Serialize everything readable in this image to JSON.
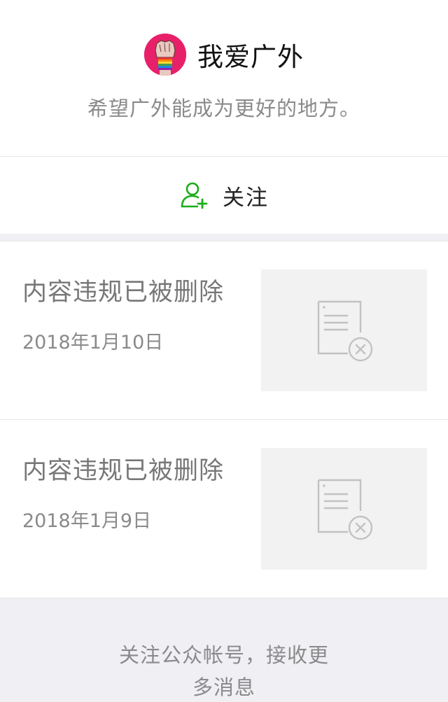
{
  "header": {
    "account_name": "我爱广外",
    "description": "希望广外能成为更好的地方。",
    "avatar_icon": "raised-fist-rainbow-icon"
  },
  "follow": {
    "label": "关注",
    "icon": "add-user-icon",
    "accent_color": "#1aad19"
  },
  "articles": [
    {
      "title": "内容违规已被删除",
      "date": "2018年1月10日",
      "thumb_icon": "deleted-document-icon"
    },
    {
      "title": "内容违规已被删除",
      "date": "2018年1月9日",
      "thumb_icon": "deleted-document-icon"
    }
  ],
  "footer": {
    "text": "关注公众帐号，接收更多消息"
  }
}
